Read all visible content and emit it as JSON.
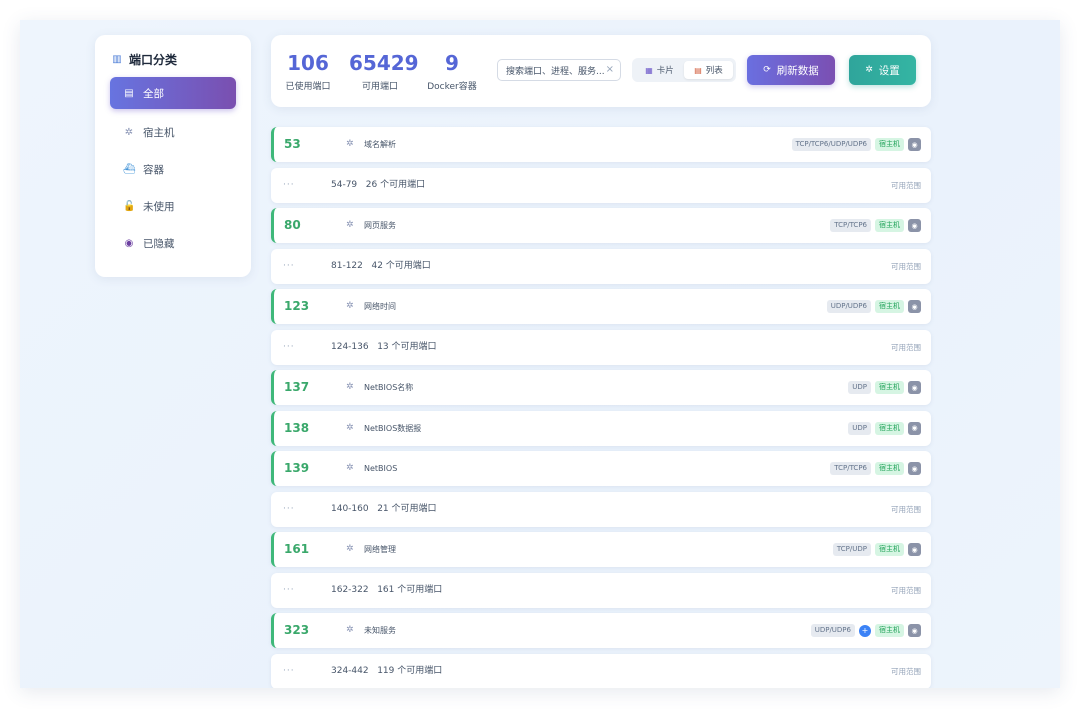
{
  "sidebar": {
    "title": "端口分类",
    "title_icon": "bar-chart-icon",
    "items": [
      {
        "label": "全部",
        "icon": "clipboard-icon",
        "glyph": "▤",
        "active": true
      },
      {
        "label": "宿主机",
        "icon": "gear-icon",
        "glyph": "✲",
        "active": false
      },
      {
        "label": "容器",
        "icon": "whale-icon",
        "glyph": "⛴",
        "active": false
      },
      {
        "label": "未使用",
        "icon": "unlock-icon",
        "glyph": "🔓",
        "active": false
      },
      {
        "label": "已隐藏",
        "icon": "eye-icon",
        "glyph": "◉",
        "active": false
      }
    ]
  },
  "header": {
    "stats": [
      {
        "value": "106",
        "label": "已使用端口"
      },
      {
        "value": "65429",
        "label": "可用端口"
      },
      {
        "value": "9",
        "label": "Docker容器"
      }
    ],
    "search": {
      "value": "搜索端口、进程、服务..."
    },
    "view_toggle": {
      "card_label": "卡片",
      "list_label": "列表",
      "selected": "list"
    },
    "refresh_label": "刷新数据",
    "settings_label": "设置"
  },
  "rows": [
    {
      "type": "used",
      "port": "53",
      "service": "域名解析",
      "protocol": "TCP/TCP6/UDP/UDP6",
      "source": "宿主机"
    },
    {
      "type": "range",
      "range": "54-79",
      "count": "26 个可用端口",
      "label": "可用范围"
    },
    {
      "type": "used",
      "port": "80",
      "service": "网页服务",
      "protocol": "TCP/TCP6",
      "source": "宿主机"
    },
    {
      "type": "range",
      "range": "81-122",
      "count": "42 个可用端口",
      "label": "可用范围"
    },
    {
      "type": "used",
      "port": "123",
      "service": "网络时间",
      "protocol": "UDP/UDP6",
      "source": "宿主机"
    },
    {
      "type": "range",
      "range": "124-136",
      "count": "13 个可用端口",
      "label": "可用范围"
    },
    {
      "type": "used",
      "port": "137",
      "service": "NetBIOS名称",
      "protocol": "UDP",
      "source": "宿主机"
    },
    {
      "type": "used",
      "port": "138",
      "service": "NetBIOS数据报",
      "protocol": "UDP",
      "source": "宿主机"
    },
    {
      "type": "used",
      "port": "139",
      "service": "NetBIOS",
      "protocol": "TCP/TCP6",
      "source": "宿主机"
    },
    {
      "type": "range",
      "range": "140-160",
      "count": "21 个可用端口",
      "label": "可用范围"
    },
    {
      "type": "used",
      "port": "161",
      "service": "网络管理",
      "protocol": "TCP/UDP",
      "source": "宿主机"
    },
    {
      "type": "range",
      "range": "162-322",
      "count": "161 个可用端口",
      "label": "可用范围"
    },
    {
      "type": "used",
      "port": "323",
      "service": "未知服务",
      "protocol": "UDP/UDP6",
      "source": "宿主机",
      "plus": true
    },
    {
      "type": "range",
      "range": "324-442",
      "count": "119 个可用端口",
      "label": "可用范围"
    }
  ]
}
